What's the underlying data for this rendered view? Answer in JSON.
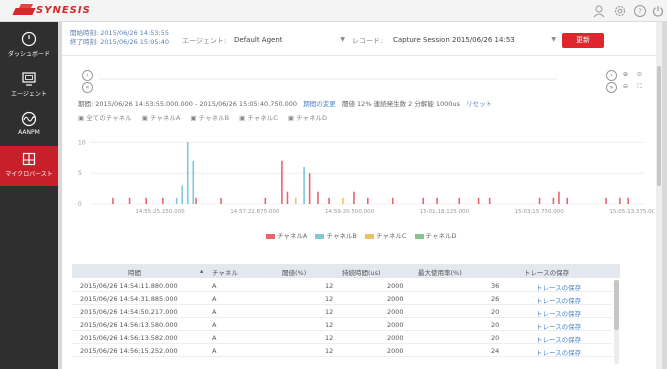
{
  "app": {
    "logo_text": "SYNESIS",
    "brand_color": "#d9252b"
  },
  "topbar": {
    "icons": [
      "user-icon",
      "gear-icon",
      "help-icon",
      "power-icon"
    ]
  },
  "sidebar": {
    "items": [
      {
        "label": "ダッシュボード",
        "icon": "dashboard-icon",
        "active": false
      },
      {
        "label": "エージェント",
        "icon": "agent-monitor-icon",
        "active": false
      },
      {
        "label": "AANPM",
        "icon": "aanpm-wave-icon",
        "active": false
      },
      {
        "label": "マイクロバースト",
        "icon": "microburst-book-icon",
        "active": true
      }
    ]
  },
  "filter": {
    "start_time": "開始時刻: 2015/06/26 14:53:55",
    "end_time": "終了時刻: 2015/06/26 15:05:40",
    "agent_label": "エージェント:",
    "agent_value": "Default Agent",
    "record_label": "レコード:",
    "record_value": "Capture Session 2015/06/26 14:53",
    "update_label": "更新"
  },
  "period": {
    "range_text": "期間: 2015/06/26 14:53:55.000.000 - 2015/06/26 15:05:40.750.000",
    "change_link": "期間の変更",
    "stats_text": "閾値 12% 連続発生数 2 分解能 1000us",
    "reset_link": "リセット"
  },
  "channel_filters": [
    "全てのチャネル",
    "チャネルA",
    "チャネルB",
    "チャネルC",
    "チャネルD"
  ],
  "chart_data": {
    "type": "bar",
    "y_ticks": [
      "10",
      "5",
      "0"
    ],
    "ylim": [
      0,
      12
    ],
    "x_tick_labels": [
      "14:55:25.250.000",
      "14:57:22.875.000",
      "14:59:20.500.000",
      "15:01:18.125.000",
      "15:03:15.750.000",
      "15:05:13.375.000"
    ],
    "series": [
      {
        "name": "チャネルA",
        "color": "#e8656e"
      },
      {
        "name": "チャネルB",
        "color": "#7fc7d9"
      },
      {
        "name": "チャネルC",
        "color": "#e9c463"
      },
      {
        "name": "チャネルD",
        "color": "#86c48b"
      }
    ],
    "bars": [
      {
        "pos": 0.04,
        "value": 1,
        "series": 0
      },
      {
        "pos": 0.07,
        "value": 1,
        "series": 0
      },
      {
        "pos": 0.1,
        "value": 1,
        "series": 0
      },
      {
        "pos": 0.13,
        "value": 1,
        "series": 0
      },
      {
        "pos": 0.155,
        "value": 1,
        "series": 1
      },
      {
        "pos": 0.165,
        "value": 3,
        "series": 1
      },
      {
        "pos": 0.175,
        "value": 10,
        "series": 1
      },
      {
        "pos": 0.185,
        "value": 7,
        "series": 1
      },
      {
        "pos": 0.19,
        "value": 1,
        "series": 0
      },
      {
        "pos": 0.235,
        "value": 1,
        "series": 0
      },
      {
        "pos": 0.315,
        "value": 1,
        "series": 0
      },
      {
        "pos": 0.345,
        "value": 7,
        "series": 0
      },
      {
        "pos": 0.355,
        "value": 2,
        "series": 0
      },
      {
        "pos": 0.37,
        "value": 1,
        "series": 2
      },
      {
        "pos": 0.385,
        "value": 6,
        "series": 1
      },
      {
        "pos": 0.395,
        "value": 5,
        "series": 0
      },
      {
        "pos": 0.41,
        "value": 2,
        "series": 0
      },
      {
        "pos": 0.43,
        "value": 1,
        "series": 0
      },
      {
        "pos": 0.455,
        "value": 1,
        "series": 2
      },
      {
        "pos": 0.475,
        "value": 2,
        "series": 0
      },
      {
        "pos": 0.5,
        "value": 1,
        "series": 0
      },
      {
        "pos": 0.545,
        "value": 1,
        "series": 0
      },
      {
        "pos": 0.6,
        "value": 1,
        "series": 0
      },
      {
        "pos": 0.625,
        "value": 1,
        "series": 0
      },
      {
        "pos": 0.665,
        "value": 1,
        "series": 0
      },
      {
        "pos": 0.7,
        "value": 1,
        "series": 0
      },
      {
        "pos": 0.72,
        "value": 1,
        "series": 0
      },
      {
        "pos": 0.81,
        "value": 1,
        "series": 0
      },
      {
        "pos": 0.835,
        "value": 1,
        "series": 0
      },
      {
        "pos": 0.845,
        "value": 2,
        "series": 0
      },
      {
        "pos": 0.86,
        "value": 1,
        "series": 0
      },
      {
        "pos": 0.93,
        "value": 1,
        "series": 0
      },
      {
        "pos": 0.955,
        "value": 1,
        "series": 0
      },
      {
        "pos": 0.97,
        "value": 1,
        "series": 0
      }
    ]
  },
  "table": {
    "headers": [
      "時間",
      "チャネル",
      "閾値(%)",
      "持続時間(us)",
      "最大使用率(%)",
      "トレースの保存"
    ],
    "rows": [
      [
        "2015/06/26 14:54:11.880.000",
        "A",
        "12",
        "2000",
        "36",
        "トレースの保存"
      ],
      [
        "2015/06/26 14:54:31.885.000",
        "A",
        "12",
        "2000",
        "26",
        "トレースの保存"
      ],
      [
        "2015/06/26 14:54:50.217.000",
        "A",
        "12",
        "2000",
        "20",
        "トレースの保存"
      ],
      [
        "2015/06/26 14:56:13.580.000",
        "A",
        "12",
        "2000",
        "20",
        "トレースの保存"
      ],
      [
        "2015/06/26 14:56:13.582.000",
        "A",
        "12",
        "2000",
        "20",
        "トレースの保存"
      ],
      [
        "2015/06/26 14:56:15.252.000",
        "A",
        "12",
        "2000",
        "24",
        "トレースの保存"
      ]
    ]
  }
}
